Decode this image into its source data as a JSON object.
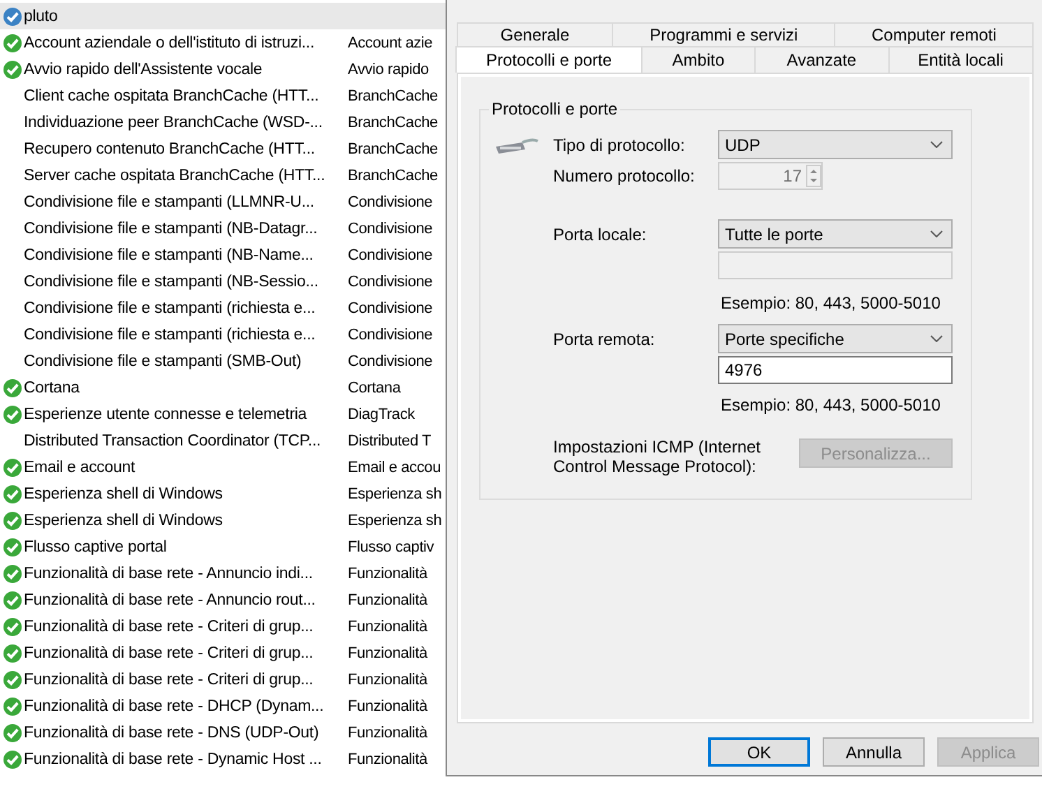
{
  "list": {
    "rows": [
      {
        "name": "pluto",
        "enabled": true,
        "selected": true
      },
      {
        "name": "Account aziendale o dell'istituto di istruzi...",
        "group": "Account azie",
        "enabled": true,
        "selected": false
      },
      {
        "name": "Avvio rapido dell'Assistente vocale",
        "group": "Avvio rapido",
        "enabled": true,
        "selected": false
      },
      {
        "name": "Client cache ospitata BranchCache (HTT...",
        "group": "BranchCache",
        "enabled": false,
        "selected": false
      },
      {
        "name": "Individuazione peer BranchCache (WSD-...",
        "group": "BranchCache",
        "enabled": false,
        "selected": false
      },
      {
        "name": "Recupero contenuto BranchCache (HTT...",
        "group": "BranchCache",
        "enabled": false,
        "selected": false
      },
      {
        "name": "Server cache ospitata BranchCache (HTT...",
        "group": "BranchCache",
        "enabled": false,
        "selected": false
      },
      {
        "name": "Condivisione file e stampanti (LLMNR-U...",
        "group": "Condivisione",
        "enabled": false,
        "selected": false
      },
      {
        "name": "Condivisione file e stampanti (NB-Datagr...",
        "group": "Condivisione",
        "enabled": false,
        "selected": false
      },
      {
        "name": "Condivisione file e stampanti (NB-Name...",
        "group": "Condivisione",
        "enabled": false,
        "selected": false
      },
      {
        "name": "Condivisione file e stampanti (NB-Sessio...",
        "group": "Condivisione",
        "enabled": false,
        "selected": false
      },
      {
        "name": "Condivisione file e stampanti (richiesta e...",
        "group": "Condivisione",
        "enabled": false,
        "selected": false
      },
      {
        "name": "Condivisione file e stampanti (richiesta e...",
        "group": "Condivisione",
        "enabled": false,
        "selected": false
      },
      {
        "name": "Condivisione file e stampanti (SMB-Out)",
        "group": "Condivisione",
        "enabled": false,
        "selected": false
      },
      {
        "name": "Cortana",
        "group": "Cortana",
        "enabled": true,
        "selected": false
      },
      {
        "name": "Esperienze utente connesse e telemetria",
        "group": "DiagTrack",
        "enabled": true,
        "selected": false
      },
      {
        "name": "Distributed Transaction Coordinator (TCP...",
        "group": "Distributed T",
        "enabled": false,
        "selected": false
      },
      {
        "name": "Email e account",
        "group": "Email e accou",
        "enabled": true,
        "selected": false
      },
      {
        "name": "Esperienza shell di Windows",
        "group": "Esperienza sh",
        "enabled": true,
        "selected": false
      },
      {
        "name": "Esperienza shell di Windows",
        "group": "Esperienza sh",
        "enabled": true,
        "selected": false
      },
      {
        "name": "Flusso captive portal",
        "group": "Flusso captiv",
        "enabled": true,
        "selected": false
      },
      {
        "name": "Funzionalità di base rete - Annuncio indi...",
        "group": "Funzionalità",
        "enabled": true,
        "selected": false
      },
      {
        "name": "Funzionalità di base rete - Annuncio rout...",
        "group": "Funzionalità",
        "enabled": true,
        "selected": false
      },
      {
        "name": "Funzionalità di base rete - Criteri di grup...",
        "group": "Funzionalità",
        "enabled": true,
        "selected": false
      },
      {
        "name": "Funzionalità di base rete - Criteri di grup...",
        "group": "Funzionalità",
        "enabled": true,
        "selected": false
      },
      {
        "name": "Funzionalità di base rete - Criteri di grup...",
        "group": "Funzionalità",
        "enabled": true,
        "selected": false
      },
      {
        "name": "Funzionalità di base rete - DHCP (Dynam...",
        "group": "Funzionalità",
        "enabled": true,
        "selected": false
      },
      {
        "name": "Funzionalità di base rete - DNS (UDP-Out)",
        "group": "Funzionalità",
        "enabled": true,
        "selected": false
      },
      {
        "name": "Funzionalità di base rete - Dynamic Host ...",
        "group": "Funzionalità",
        "enabled": true,
        "selected": false
      }
    ]
  },
  "dialog": {
    "tabs_back": [
      {
        "label": "Generale",
        "selected": false
      },
      {
        "label": "Programmi e servizi",
        "selected": false
      },
      {
        "label": "Computer remoti",
        "selected": false
      }
    ],
    "tabs_front": [
      {
        "label": "Protocolli e porte",
        "selected": true
      },
      {
        "label": "Ambito",
        "selected": false
      },
      {
        "label": "Avanzate",
        "selected": false
      },
      {
        "label": "Entità locali",
        "selected": false
      }
    ],
    "group": {
      "title": "Protocolli e porte",
      "protocol_type": {
        "label": "Tipo di protocollo:",
        "value": "UDP"
      },
      "protocol_number": {
        "label": "Numero protocollo:",
        "value": "17",
        "disabled": true
      },
      "local_port": {
        "label": "Porta locale:",
        "value": "Tutte le porte",
        "ports": {
          "disabled": true
        },
        "hint": "Esempio: 80, 443, 5000-5010"
      },
      "remote_port": {
        "label": "Porta remota:",
        "value": "Porte specifiche",
        "ports": {
          "value": "4976",
          "disabled": false
        },
        "hint": "Esempio: 80, 443, 5000-5010"
      },
      "icmp": {
        "label": "Impostazioni ICMP (Internet Control Message Protocol):",
        "button": {
          "label": "Personalizza...",
          "disabled": true
        }
      }
    },
    "buttons": [
      {
        "label": "OK",
        "focused": true,
        "disabled": false
      },
      {
        "label": "Annulla",
        "focused": false,
        "disabled": false
      },
      {
        "label": "Applica",
        "focused": false,
        "disabled": true
      }
    ]
  }
}
